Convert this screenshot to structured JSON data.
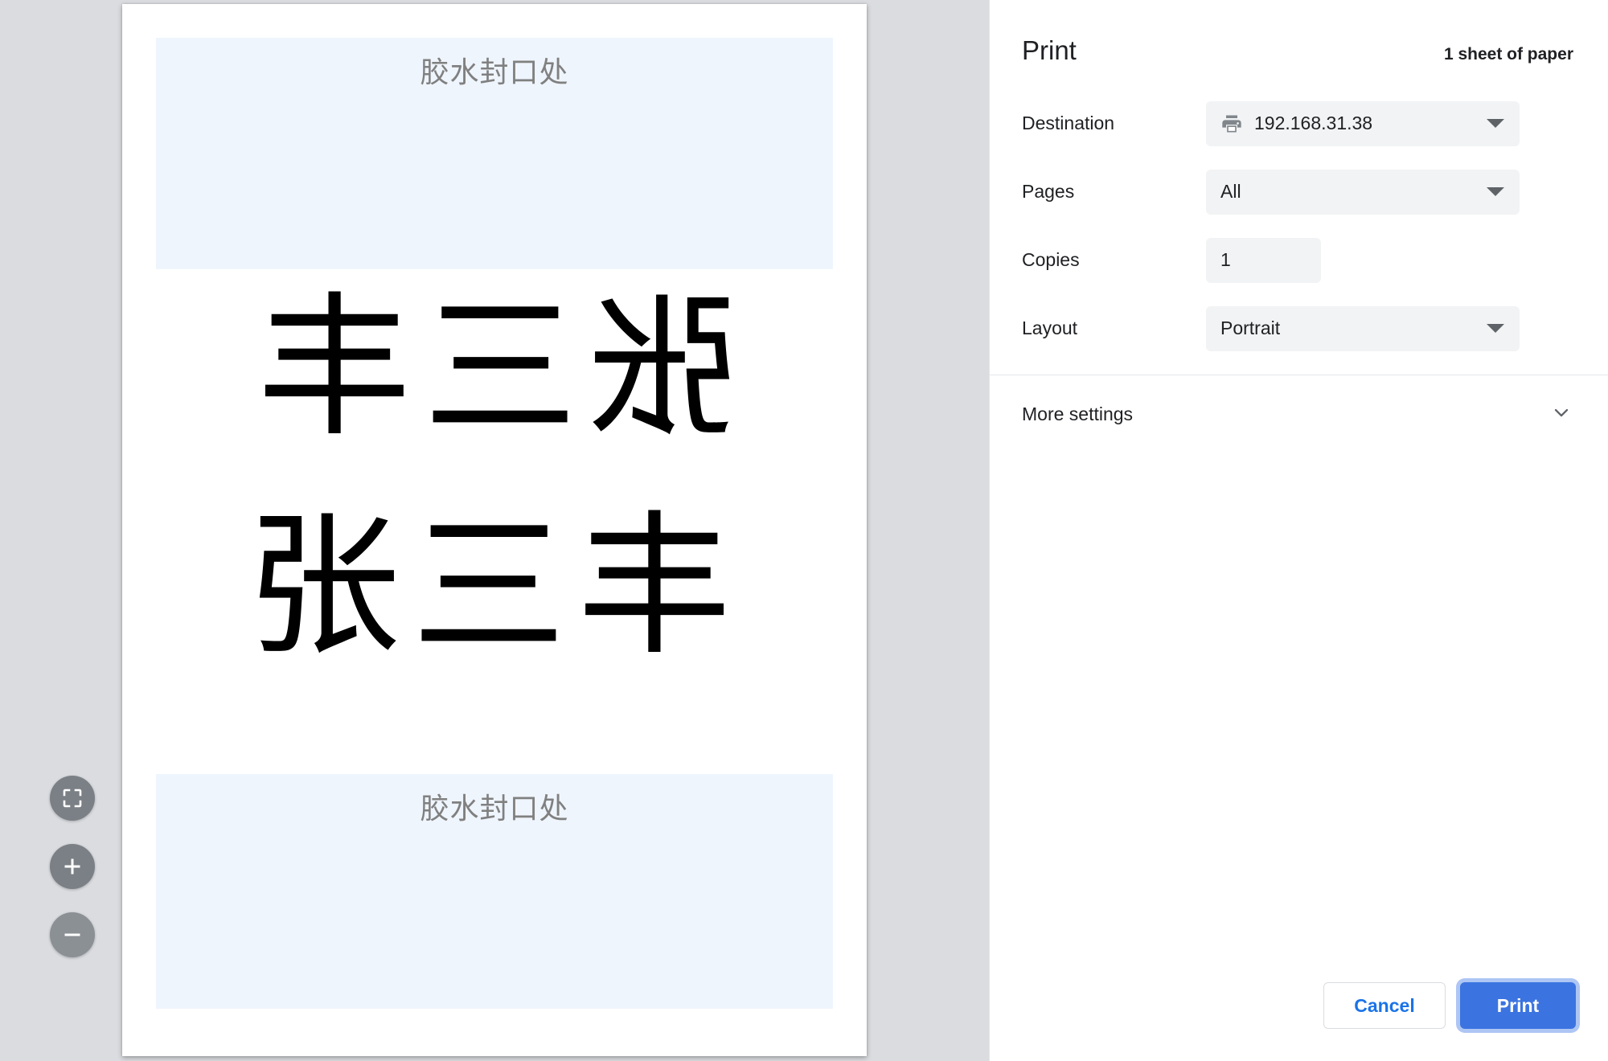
{
  "preview": {
    "glue_band_top_text": "胶水封口处",
    "glue_band_bottom_text": "胶水封口处",
    "name_line_reversed": "张三丰",
    "name_line_normal": "张三丰",
    "glue_band_color": "#eff5fd",
    "page_background": "#ffffff",
    "workspace_background": "#dadce0"
  },
  "zoom_controls": {
    "fit_label": "fit-to-page",
    "zoom_in_label": "zoom-in",
    "zoom_out_label": "zoom-out"
  },
  "panel": {
    "title": "Print",
    "sheet_summary": "1 sheet of paper",
    "settings": [
      {
        "label": "Destination",
        "value": "192.168.31.38",
        "control": "dropdown",
        "icon": "printer-icon"
      },
      {
        "label": "Pages",
        "value": "All",
        "control": "dropdown"
      },
      {
        "label": "Copies",
        "value": "1",
        "control": "textfield"
      },
      {
        "label": "Layout",
        "value": "Portrait",
        "control": "dropdown"
      }
    ],
    "more_settings": {
      "label": "More settings",
      "icon": "chevron-down-icon"
    },
    "actions": {
      "cancel_label": "Cancel",
      "print_label": "Print"
    },
    "accent_color": "#1a73e8",
    "primary_button_color": "#3b74e0",
    "control_background": "#f1f3f4"
  }
}
